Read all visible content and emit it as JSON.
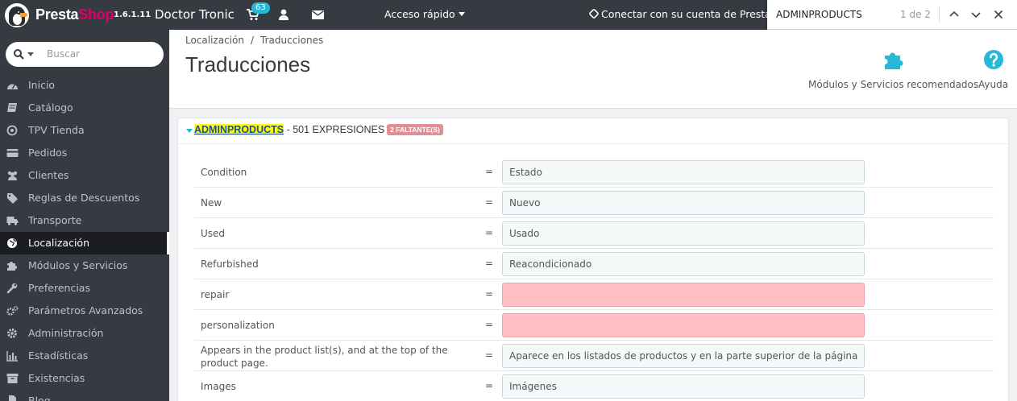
{
  "topbar": {
    "brand_presta": "Presta",
    "brand_shop": "Shop",
    "version": "1.6.1.11",
    "shop_name": "Doctor Tronic",
    "cart_badge": "63",
    "quick_access": "Acceso rápido",
    "connect": "Conectar con su cuenta de PrestaShop"
  },
  "findbar": {
    "query": "ADMINPRODUCTS",
    "count": "1 de 2"
  },
  "sidebar": {
    "search_placeholder": "Buscar",
    "items": [
      {
        "label": "Inicio",
        "icon": "dashboard-icon"
      },
      {
        "label": "Catálogo",
        "icon": "book-icon"
      },
      {
        "label": "TPV Tienda",
        "icon": "target-icon"
      },
      {
        "label": "Pedidos",
        "icon": "credit-card-icon"
      },
      {
        "label": "Clientes",
        "icon": "users-icon"
      },
      {
        "label": "Reglas de Descuentos",
        "icon": "tag-icon"
      },
      {
        "label": "Transporte",
        "icon": "truck-icon"
      },
      {
        "label": "Localización",
        "icon": "globe-icon",
        "active": true
      },
      {
        "label": "Módulos y Servicios",
        "icon": "puzzle-icon"
      },
      {
        "label": "Preferencias",
        "icon": "wrench-icon"
      },
      {
        "label": "Parámetros Avanzados",
        "icon": "cogs-icon"
      },
      {
        "label": "Administración",
        "icon": "gear-icon"
      },
      {
        "label": "Estadísticas",
        "icon": "bar-chart-icon"
      },
      {
        "label": "Existencias",
        "icon": "archive-icon"
      },
      {
        "label": "Blog",
        "icon": "file-icon"
      }
    ]
  },
  "header": {
    "breadcrumb_parent": "Localización",
    "breadcrumb_sep": "/",
    "breadcrumb_current": "Traducciones",
    "title": "Traducciones",
    "modules_label": "Módulos y Servicios recomendados",
    "help_label": "Ayuda"
  },
  "panel": {
    "section_name": "ADMINPRODUCTS",
    "expressions": " - 501 EXPRESIONES",
    "missing": "2 FALTANTE(S)",
    "rows": [
      {
        "source": "Condition",
        "translation": "Estado",
        "missing": false
      },
      {
        "source": "New",
        "translation": "Nuevo",
        "missing": false
      },
      {
        "source": "Used",
        "translation": "Usado",
        "missing": false
      },
      {
        "source": "Refurbished",
        "translation": "Reacondicionado",
        "missing": false
      },
      {
        "source": "repair",
        "translation": "",
        "missing": true
      },
      {
        "source": "personalization",
        "translation": "",
        "missing": true
      },
      {
        "source": "Appears in the product list(s), and at the top of the product page.",
        "translation": "Aparece en los listados de productos y en la parte superior de la página del producto.",
        "missing": false
      },
      {
        "source": "Images",
        "translation": "Imágenes",
        "missing": false
      }
    ],
    "equals": "="
  },
  "colors": {
    "sidebar_bg": "#363a41",
    "accent": "#25b9d7",
    "missing_field": "#ffbfc3",
    "highlight": "#ffff00",
    "brand_pink": "#df0067"
  }
}
